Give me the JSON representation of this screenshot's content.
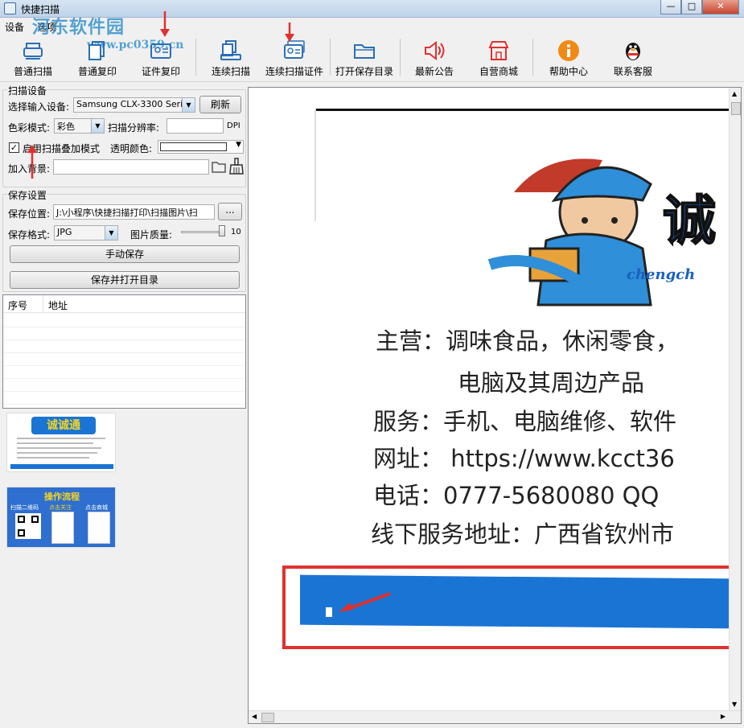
{
  "window": {
    "title": "快捷扫描",
    "min": "—",
    "max": "□",
    "close": "✕"
  },
  "menu": {
    "items": [
      "设备",
      "选项"
    ]
  },
  "watermark": {
    "text": "河东软件园",
    "url": "www.pc0359.cn"
  },
  "toolbar": {
    "buttons": [
      {
        "label": "普通扫描",
        "icon": "scanner-icon"
      },
      {
        "label": "普通复印",
        "icon": "copy-icon"
      },
      {
        "label": "证件复印",
        "icon": "id-card-icon"
      },
      {
        "label": "连续扫描",
        "icon": "continuous-scan-icon"
      },
      {
        "label": "连续扫描证件",
        "icon": "continuous-id-scan-icon"
      },
      {
        "label": "打开保存目录",
        "icon": "folder-icon"
      },
      {
        "label": "最新公告",
        "icon": "speaker-icon"
      },
      {
        "label": "自营商城",
        "icon": "store-icon"
      },
      {
        "label": "帮助中心",
        "icon": "info-icon"
      },
      {
        "label": "联系客服",
        "icon": "qq-penguin-icon"
      }
    ]
  },
  "scan_settings": {
    "legend": "扫描设备",
    "device_label": "选择输入设备:",
    "device_value": "Samsung CLX-3300 Seri",
    "refresh": "刷新",
    "color_label": "色彩模式:",
    "color_value": "彩色",
    "dpi_label": "扫描分辨率:",
    "dpi_value": "",
    "dpi_unit": "DPI",
    "overlay_label": "启用扫描叠加模式",
    "overlay_checked": true,
    "transparent_label": "透明颜色:",
    "background_label": "加入背景:",
    "background_value": ""
  },
  "save_settings": {
    "legend": "保存设置",
    "location_label": "保存位置:",
    "location_value": "J:\\小程序\\快捷扫描打印\\扫描图片\\扫",
    "browse": "...",
    "format_label": "保存格式:",
    "format_value": "JPG",
    "quality_label": "图片质量:",
    "quality_value": "10",
    "manual_save": "手动保存",
    "save_open": "保存并打开目录"
  },
  "table": {
    "columns": [
      "序号",
      "地址"
    ]
  },
  "thumb1": {
    "brand": "诚诚通"
  },
  "thumb2": {
    "title": "操作流程",
    "step1": "扫描二维码",
    "step2": "点击关注",
    "step3": "点击商城"
  },
  "preview": {
    "brand": "诚",
    "brand_sub": "chengch",
    "lines": [
      "主营：调味食品，休闲零食，",
      "电脑及其周边产品",
      "服务：手机、电脑维修、软件",
      "网址：  https://www.kcct36",
      "电话：0777-5680080    QQ",
      "线下服务地址：广西省钦州市"
    ]
  },
  "colors": {
    "accent": "#1e87c8",
    "annotation": "#e0312f",
    "banner": "#1a74d4"
  }
}
